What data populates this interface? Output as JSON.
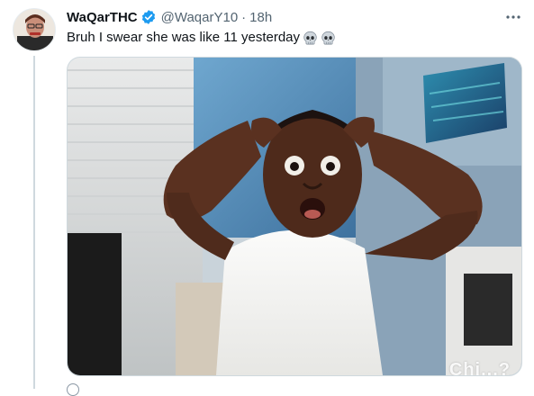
{
  "tweet": {
    "display_name": "WaQarTHC",
    "handle": "@WaqarY10",
    "separator": "·",
    "time": "18h",
    "text": "Bruh I swear she was like 11 yesterday",
    "emoji": [
      "skull-emoji",
      "skull-emoji"
    ],
    "media_watermark": "Chi...?"
  },
  "colors": {
    "verified_blue": "#1d9bf0",
    "secondary_text": "#536471",
    "thread_line": "#cfd9de"
  }
}
